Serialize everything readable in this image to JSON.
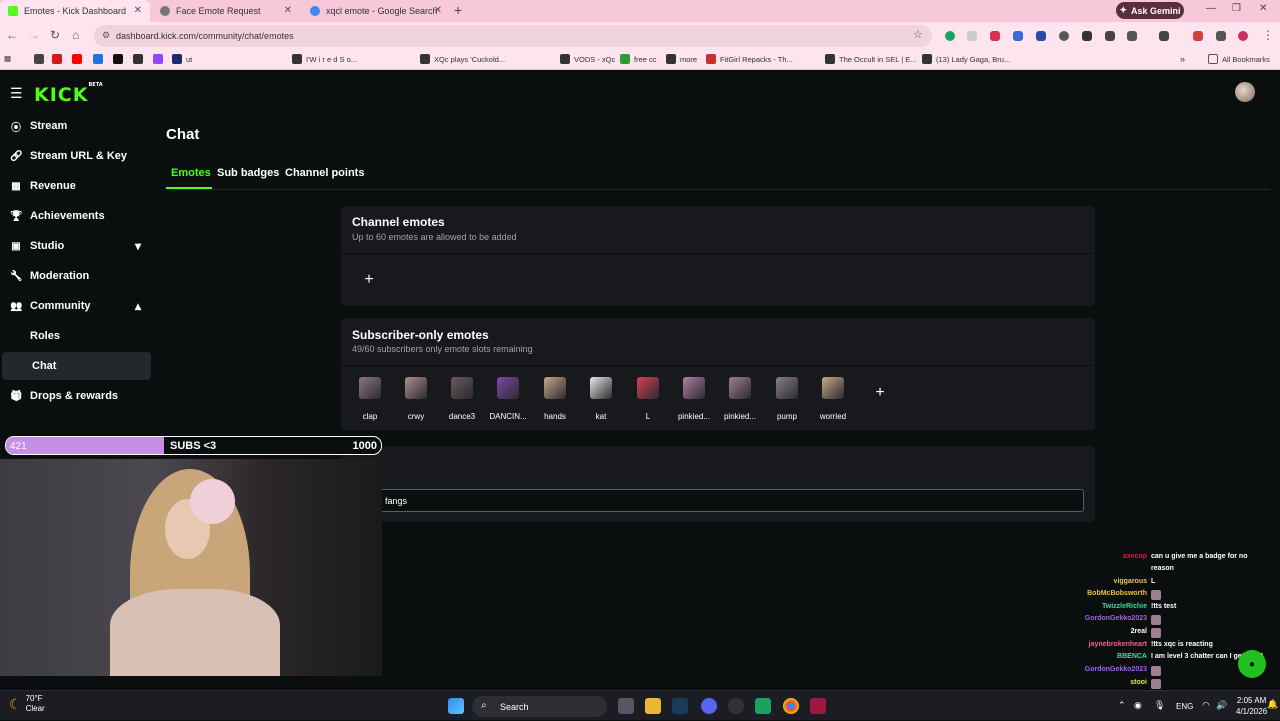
{
  "browser": {
    "tabs": [
      {
        "title": "Emotes - Kick Dashboard",
        "active": true,
        "favicon_color": "#53fc18"
      },
      {
        "title": "Face Emote Request",
        "active": false,
        "favicon_color": "#777777"
      },
      {
        "title": "xqcl emote - Google Search",
        "active": false,
        "favicon_color": "#4285f4"
      }
    ],
    "new_tab": "+",
    "ask_gemini": "Ask Gemini",
    "url": "dashboard.kick.com/community/chat/emotes",
    "bookmarks": [
      {
        "label": "",
        "color": "#444"
      },
      {
        "label": "",
        "color": "#d81818"
      },
      {
        "label": "",
        "color": "#ff0000"
      },
      {
        "label": "",
        "color": "#1e73e8"
      },
      {
        "label": "",
        "color": "#111"
      },
      {
        "label": "",
        "color": "#333"
      },
      {
        "label": "",
        "color": "#9146ff"
      },
      {
        "label": "ut",
        "color": "#1a2b6b"
      },
      {
        "label": "I'W i r e d  S o...",
        "color": "#333"
      },
      {
        "label": "XQc plays 'Cuckold...",
        "color": "#333"
      },
      {
        "label": "VODS - xQc",
        "color": "#333"
      },
      {
        "label": "free cc",
        "color": "#2a9d3a"
      },
      {
        "label": "more",
        "color": "#333"
      },
      {
        "label": "FitGirl Repacks - Th...",
        "color": "#c9302c"
      },
      {
        "label": "The Occult in SEL | E...",
        "color": "#333"
      },
      {
        "label": "(13) Lady Gaga, Bru...",
        "color": "#333"
      }
    ],
    "all_bookmarks": "All Bookmarks"
  },
  "app": {
    "logo": "KICK",
    "logo_badge": "BETA",
    "sidebar": [
      {
        "label": "Stream",
        "icon": "broadcast-icon",
        "glyph": "((·))"
      },
      {
        "label": "Stream URL & Key",
        "icon": "link-icon",
        "glyph": "🔗"
      },
      {
        "label": "Revenue",
        "icon": "chart-icon",
        "glyph": "▦"
      },
      {
        "label": "Achievements",
        "icon": "trophy-icon",
        "glyph": "🏆"
      },
      {
        "label": "Studio",
        "icon": "studio-icon",
        "glyph": "▣",
        "chevron": "⌄"
      },
      {
        "label": "Moderation",
        "icon": "wrench-icon",
        "glyph": "🔧"
      },
      {
        "label": "Community",
        "icon": "people-icon",
        "glyph": "👥",
        "chevron": "⌃"
      },
      {
        "label": "Roles",
        "icon": "",
        "glyph": ""
      },
      {
        "label": "Chat",
        "icon": "",
        "glyph": "",
        "active": true
      },
      {
        "label": "Drops & rewards",
        "icon": "gift-icon",
        "glyph": "🎁"
      }
    ],
    "page_title": "Chat",
    "tabs": [
      "Emotes",
      "Sub badges",
      "Channel points"
    ],
    "channel_emotes": {
      "title": "Channel emotes",
      "subtitle": "Up to 60 emotes are allowed to be added",
      "add": "+"
    },
    "subscriber_emotes": {
      "title": "Subscriber-only emotes",
      "subtitle": "49/60 subscribers only emote slots remaining",
      "add": "+",
      "emotes": [
        {
          "name": "clap",
          "color": "#8a7a80"
        },
        {
          "name": "crwy",
          "color": "#b09090"
        },
        {
          "name": "dance3",
          "color": "#6a5a60"
        },
        {
          "name": "DANCIN...",
          "color": "#7a4aa8"
        },
        {
          "name": "hands",
          "color": "#c8a888"
        },
        {
          "name": "kat",
          "color": "#e8e8e8"
        },
        {
          "name": "L",
          "color": "#d84050"
        },
        {
          "name": "pinkied...",
          "color": "#b080a8"
        },
        {
          "name": "pinkied...",
          "color": "#a08090"
        },
        {
          "name": "pump",
          "color": "#8a8088"
        },
        {
          "name": "worried",
          "color": "#c8a888"
        }
      ]
    },
    "third_card": {
      "input_value": "fangs"
    }
  },
  "overlay": {
    "sub_goal": {
      "current": "421",
      "label": "SUBS <3",
      "goal": "1000",
      "progress": 0.421
    },
    "chat": [
      {
        "user": "axecop",
        "color": "#d81840",
        "text": "can u give me a badge for no"
      },
      {
        "user": "",
        "color": "#ffffff",
        "text": "reason"
      },
      {
        "user": "viggarous",
        "color": "#e8c070",
        "text": "L"
      },
      {
        "user": "BobMcBobsworth",
        "color": "#f0c040",
        "text": ""
      },
      {
        "user": "TwizzleRichie",
        "color": "#40d8a0",
        "text": "!tts test"
      },
      {
        "user": "GordonGekko2023",
        "color": "#a060f0",
        "text": ""
      },
      {
        "user": "2real",
        "color": "#ffffff",
        "text": ""
      },
      {
        "user": "jaynebrokenheart",
        "color": "#f06090",
        "text": "!tts xqc is reacting"
      },
      {
        "user": "BBENCA",
        "color": "#40d8a0",
        "text": "I am level 3 chatter can I get a VIP"
      },
      {
        "user": "GordonGekko2023",
        "color": "#a060f0",
        "text": ""
      },
      {
        "user": "stooi",
        "color": "#e8e060",
        "text": ""
      }
    ]
  },
  "taskbar": {
    "temp": "70°F",
    "condition": "Clear",
    "search": "Search",
    "lang": "ENG",
    "time": "2:05 AM",
    "date": "4/1/2026"
  }
}
